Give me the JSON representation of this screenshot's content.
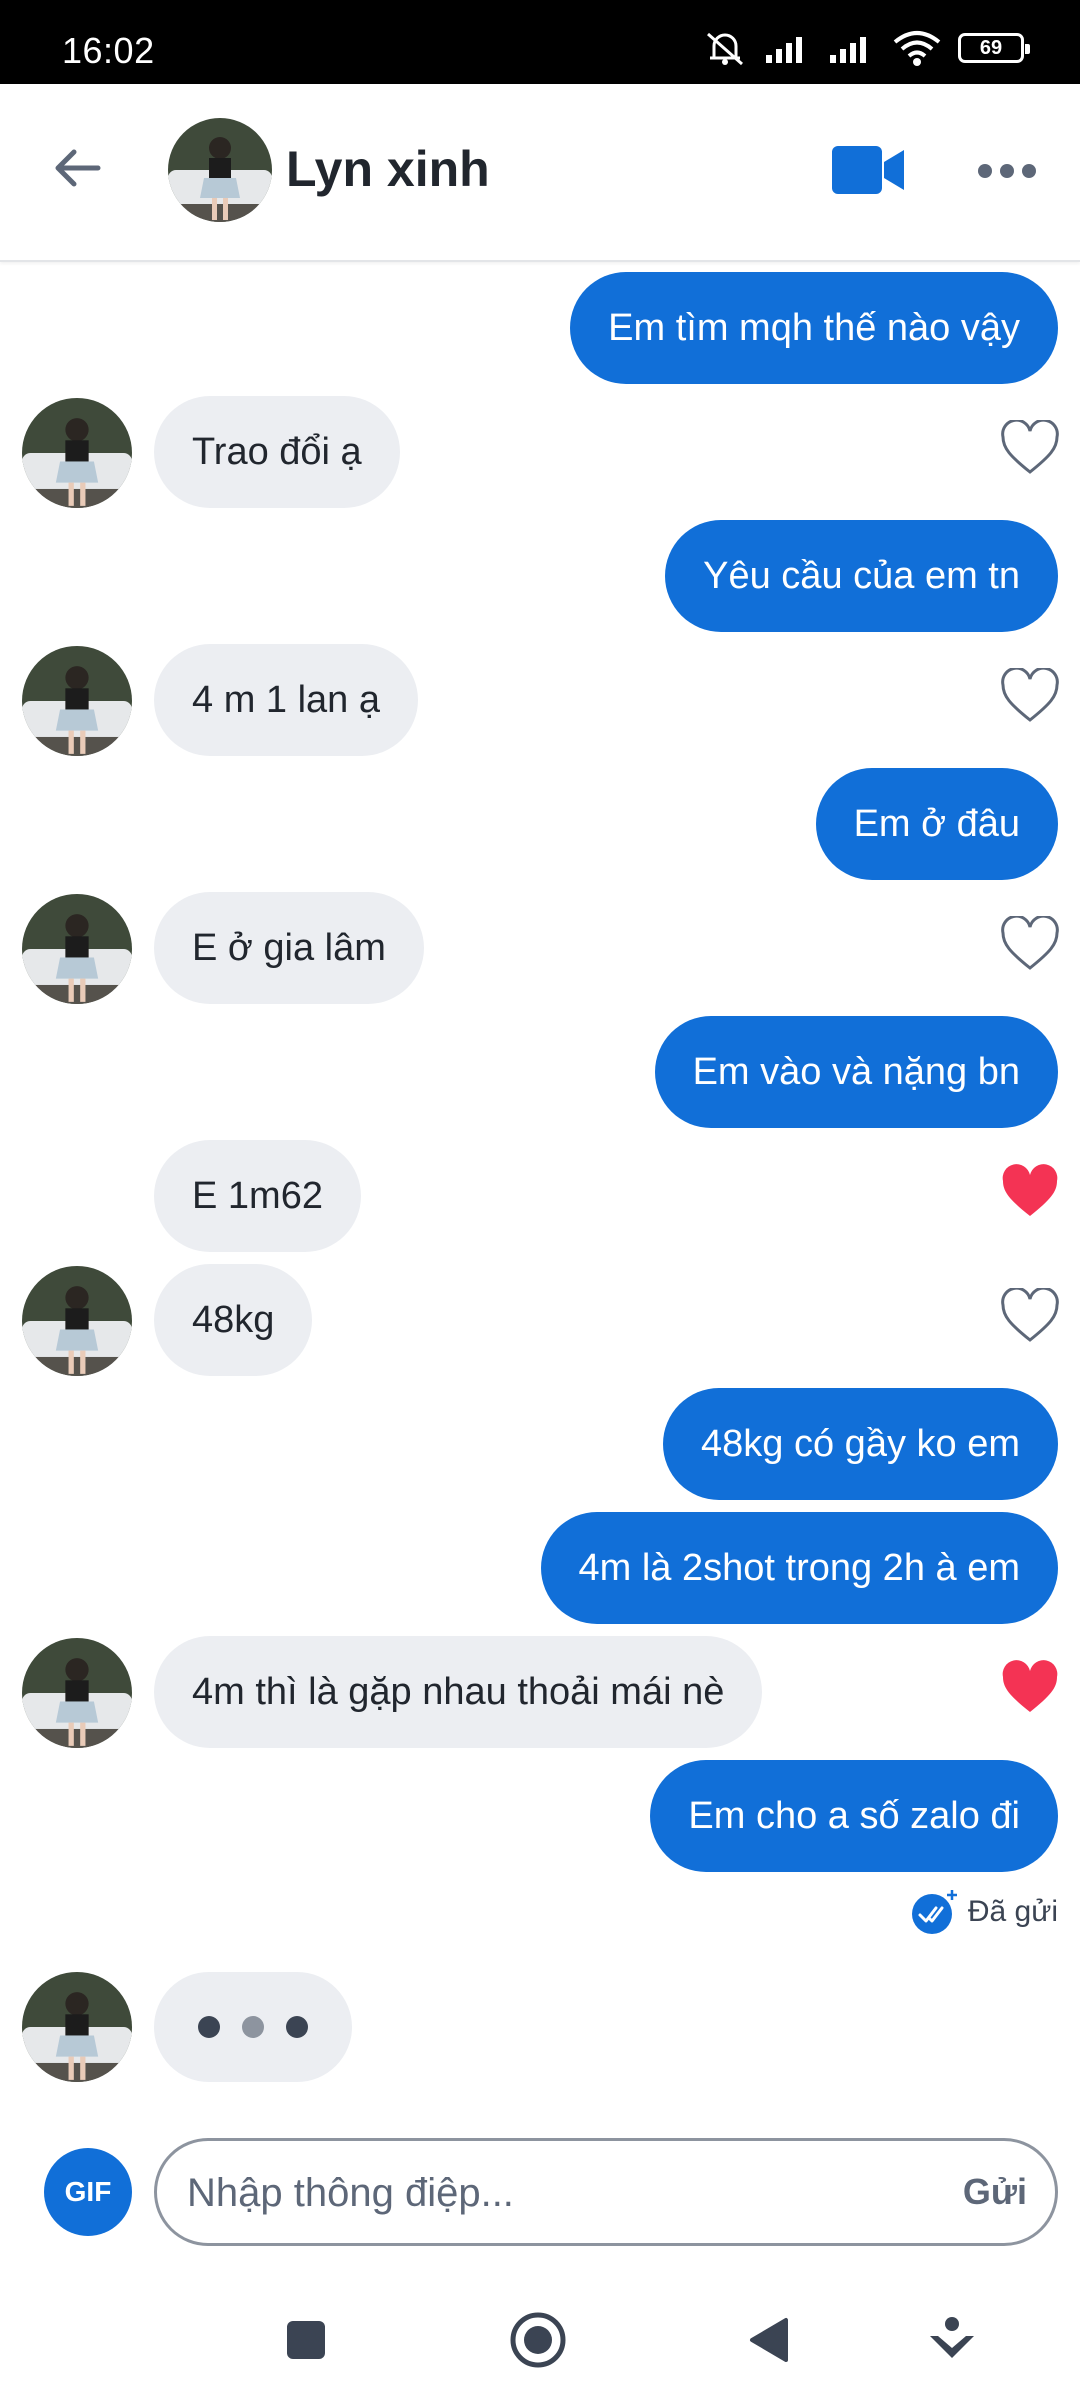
{
  "status_bar": {
    "time": "16:02",
    "battery": "69"
  },
  "header": {
    "contact_name": "Lyn xinh"
  },
  "messages": [
    {
      "text": "Em tìm mqh thế nào vậy"
    },
    {
      "text": "Trao đổi ạ"
    },
    {
      "text": "Yêu cầu của em tn"
    },
    {
      "text": "4 m 1 lan ạ"
    },
    {
      "text": "Em ở đâu"
    },
    {
      "text": "E ở gia lâm"
    },
    {
      "text": "Em vào và nặng bn"
    },
    {
      "text": "E 1m62"
    },
    {
      "text": "48kg"
    },
    {
      "text": "48kg có gầy ko em"
    },
    {
      "text": "4m là 2shot trong 2h à em"
    },
    {
      "text": "4m thì là gặp nhau thoải mái nè"
    },
    {
      "text": "Em cho a số zalo đi"
    }
  ],
  "sent_status": "Đã gửi",
  "composer": {
    "gif_label": "GIF",
    "placeholder": "Nhập thông điệp...",
    "send_label": "Gửi"
  },
  "colors": {
    "outgoing_bubble": "#116fd8",
    "incoming_bubble": "#eceef2",
    "liked_heart": "#f43354",
    "unliked_heart": "#5d6778"
  }
}
